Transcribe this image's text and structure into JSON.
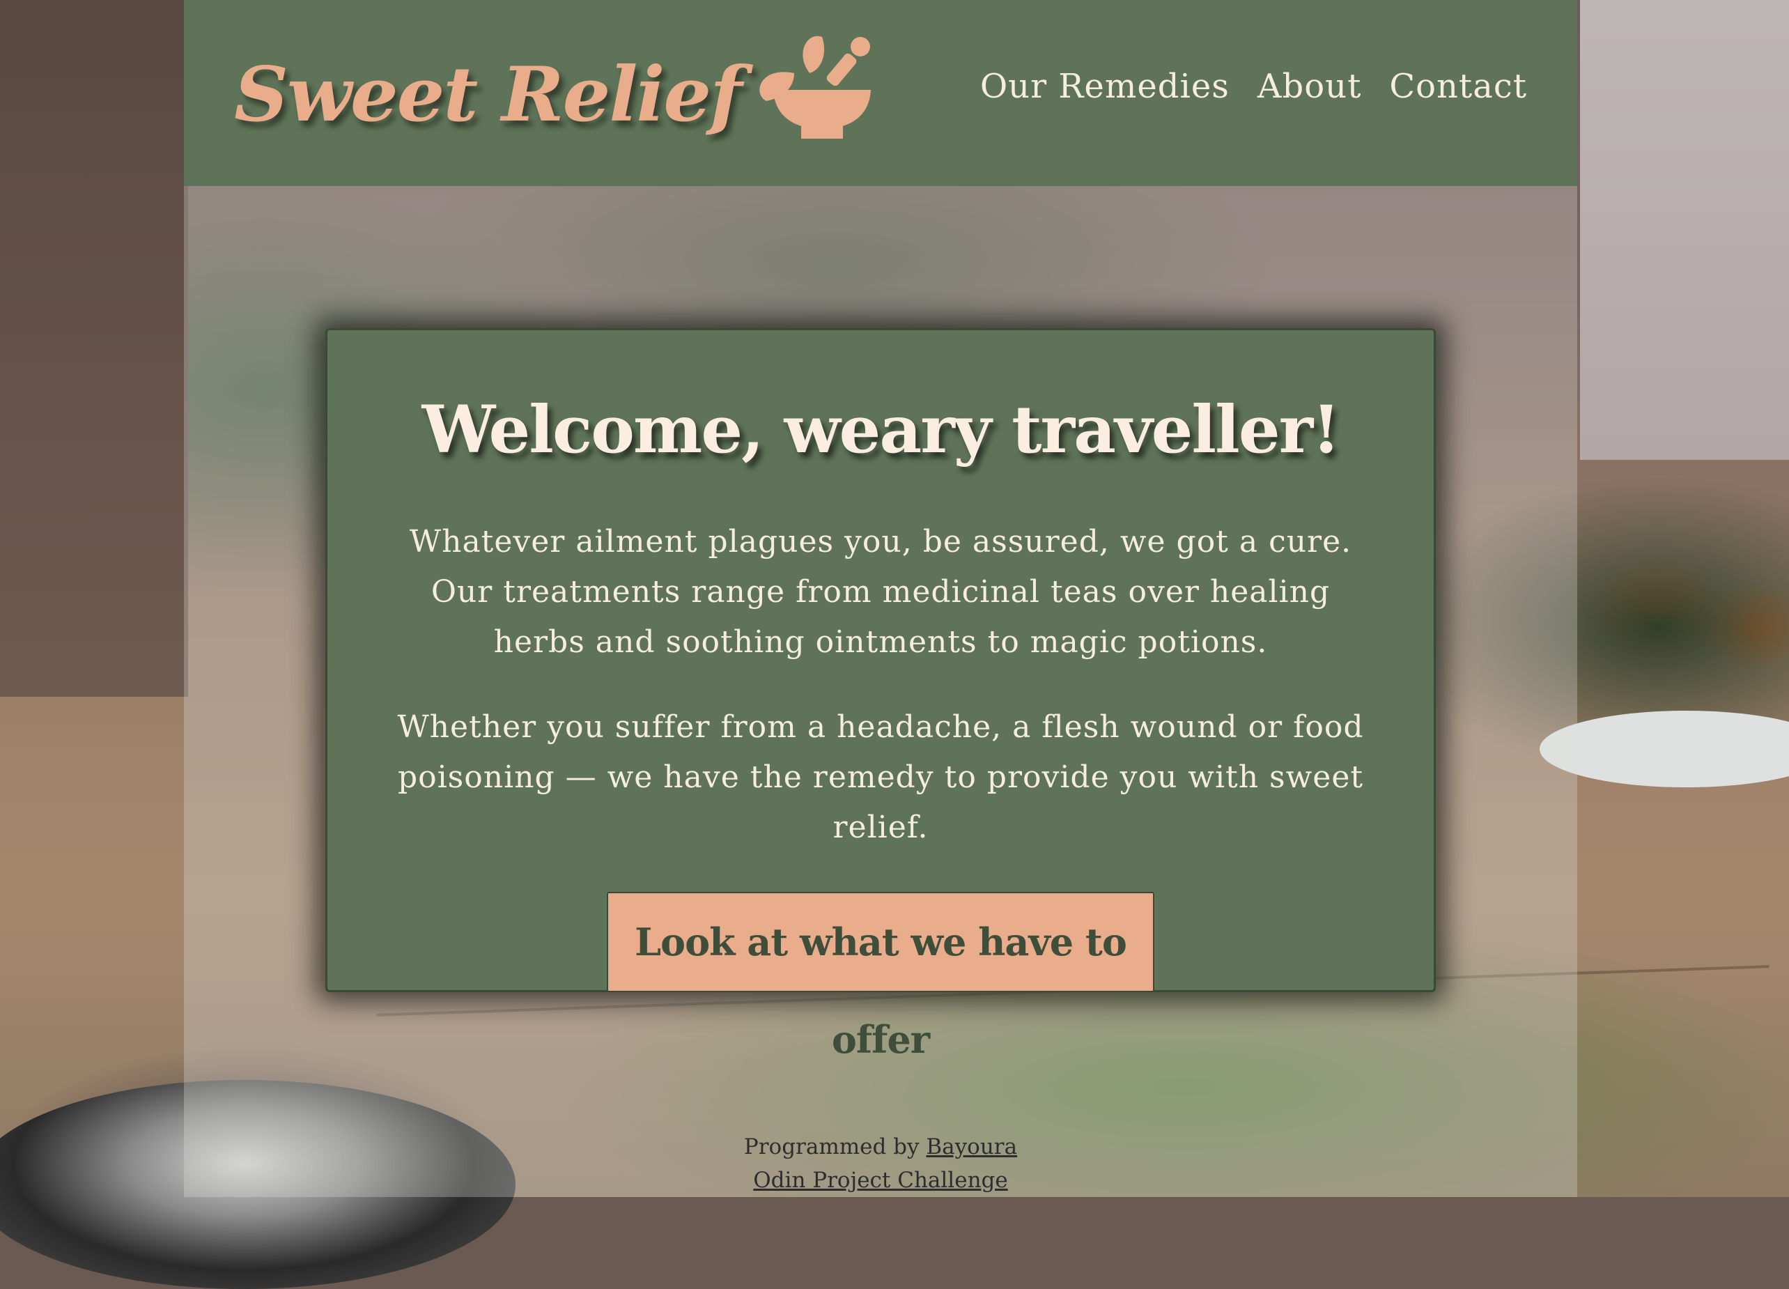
{
  "header": {
    "logo_text": "Sweet Relief",
    "logo_icon": "mortar-and-pestle-icon",
    "nav": [
      "Our Remedies",
      "About",
      "Contact"
    ]
  },
  "hero": {
    "title": "Welcome, weary traveller!",
    "paragraph_1": "Whatever ailment plagues you, be assured, we got a cure. Our treatments range from medicinal teas over healing herbs and soothing ointments to magic potions.",
    "paragraph_2": "Whether you suffer from a headache, a flesh wound or food poisoning — we have the remedy to provide you with sweet relief.",
    "cta_label": "Look at what we have to offer"
  },
  "footer": {
    "programmed_by": "Programmed by",
    "author_link": "Bayoura",
    "challenge_link": "Odin Project Challenge"
  },
  "colors": {
    "header_bg": "#5e7357",
    "accent": "#e9ad8b",
    "text_light": "#f6ede1"
  }
}
